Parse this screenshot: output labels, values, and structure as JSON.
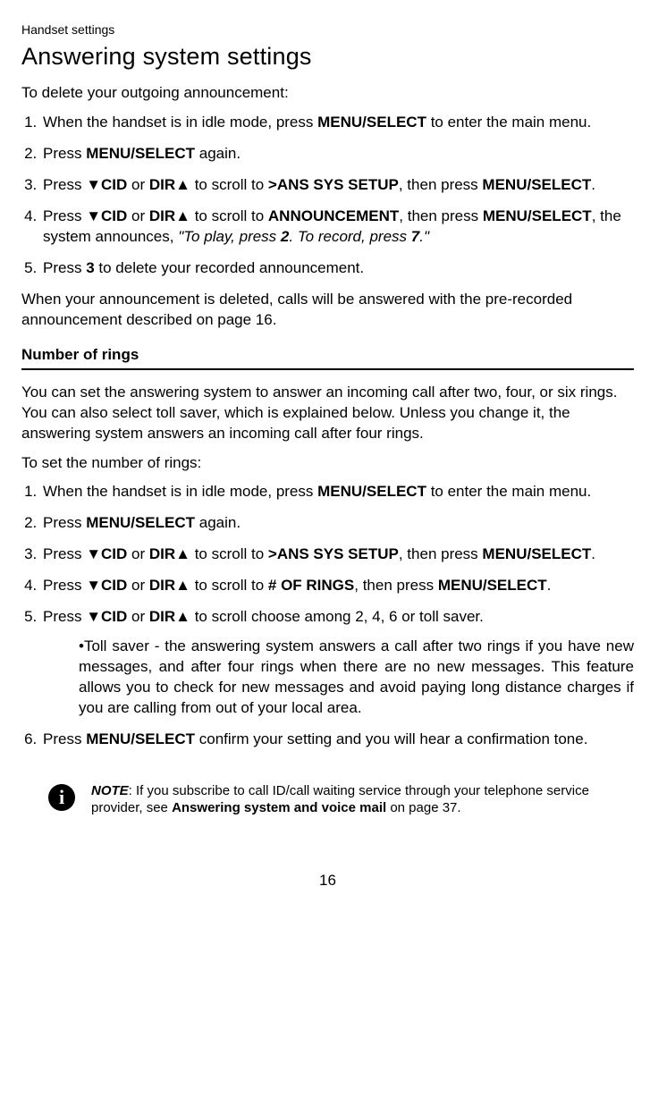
{
  "header": "Handset settings",
  "title": "Answering system settings",
  "intro1": "To delete your outgoing announcement:",
  "list1": {
    "i1a": "When the handset is in idle mode, press ",
    "i1b": "MENU/",
    "i1c": "SELECT",
    "i1d": " to enter the main menu.",
    "i2a": "Press ",
    "i2b": "MENU",
    "i2c": "/SELECT",
    "i2d": " again.",
    "i3a": "Press ",
    "i3b": "▼CID",
    "i3c": " or ",
    "i3d": "DIR▲",
    "i3e": " to scroll to ",
    "i3f": ">ANS SYS SETUP",
    "i3g": ", then press ",
    "i3h": "MENU",
    "i3i": "/SELECT",
    "i3j": ".",
    "i4a": "Press ",
    "i4b": "▼CID",
    "i4c": " or ",
    "i4d": "DIR▲",
    "i4e": " to scroll to ",
    "i4f": "ANNOUNCEMENT",
    "i4g": ", then press ",
    "i4h": "MENU",
    "i4i": "/SELECT",
    "i4j": ", the system announces, ",
    "i4k": "\"To play, press ",
    "i4l": "2",
    "i4m": ". To record, press ",
    "i4n": "7",
    "i4o": ".\"",
    "i5a": "Press ",
    "i5b": "3",
    "i5c": " to delete your recorded announcement."
  },
  "after1": "When your announcement is deleted, calls will be answered with the pre-recorded announcement described on page 16.",
  "subheading": "Number of rings",
  "para2": "You can set the answering system to answer an incoming call after two, four, or six rings. You can also select toll saver, which is explained below. Unless you change it, the answering system answers an incoming call after four rings.",
  "intro2": "To set the number of rings:",
  "list2": {
    "i1a": "When the handset is in idle mode, press ",
    "i1b": "MENU/",
    "i1c": "SELECT",
    "i1d": " to enter the main menu.",
    "i2a": "Press ",
    "i2b": "MENU",
    "i2c": "/SELECT",
    "i2d": " again.",
    "i3a": "Press ",
    "i3b": "▼CID",
    "i3c": " or ",
    "i3d": "DIR▲",
    "i3e": " to scroll to ",
    "i3f": ">ANS SYS SETUP",
    "i3g": ", then press ",
    "i3h": "MENU",
    "i3i": "/SELECT",
    "i3j": ".",
    "i4a": "Press ",
    "i4b": "▼CID",
    "i4c": " or ",
    "i4d": "DIR▲",
    "i4e": " to scroll to ",
    "i4f": "# OF RINGS",
    "i4g": ", then press ",
    "i4h": "MENU",
    "i4i": "/SELECT",
    "i4j": ".",
    "i5a": "Press ",
    "i5b": "▼CID",
    "i5c": " or ",
    "i5d": "DIR▲",
    "i5e": " to scroll choose among 2, 4, 6 or toll saver.",
    "bullet": "•Toll saver - the answering system answers a call after two rings if you have new messages, and after four rings when there are no new messages. This feature allows you to check for new messages and avoid paying long distance charges if you are calling from out of your local area.",
    "i6a": "Press ",
    "i6b": "MENU",
    "i6c": "/SELECT",
    "i6d": " confirm your setting and you will hear a confirmation tone."
  },
  "note": {
    "label": "NOTE",
    "a": ": If you subscribe to call ID/call waiting service through your telephone service provider, see  ",
    "b": "Answering system and voice mail",
    "c": " on page 37."
  },
  "pagenum": "16"
}
